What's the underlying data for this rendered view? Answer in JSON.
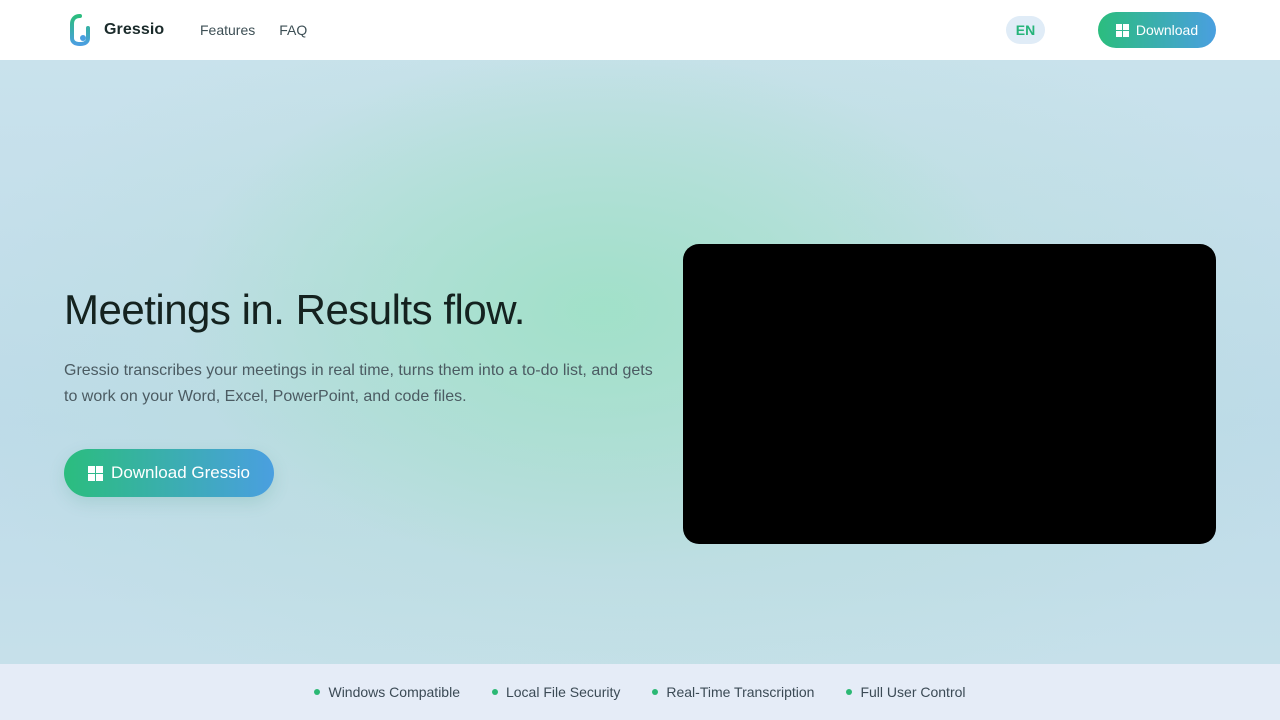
{
  "header": {
    "brand": "Gressio",
    "nav": [
      "Features",
      "FAQ"
    ],
    "language": "EN",
    "download_label": "Download"
  },
  "hero": {
    "title": "Meetings in. Results flow.",
    "description": "Gressio transcribes your meetings in real time, turns them into a to-do list, and gets to work on your Word, Excel, PowerPoint, and code files.",
    "download_label": "Download Gressio"
  },
  "features": [
    "Windows Compatible",
    "Local File Security",
    "Real-Time Transcription",
    "Full User Control"
  ],
  "colors": {
    "accent_green": "#2bbd7e",
    "accent_blue": "#4a9fe0",
    "video_bg": "#000000"
  }
}
